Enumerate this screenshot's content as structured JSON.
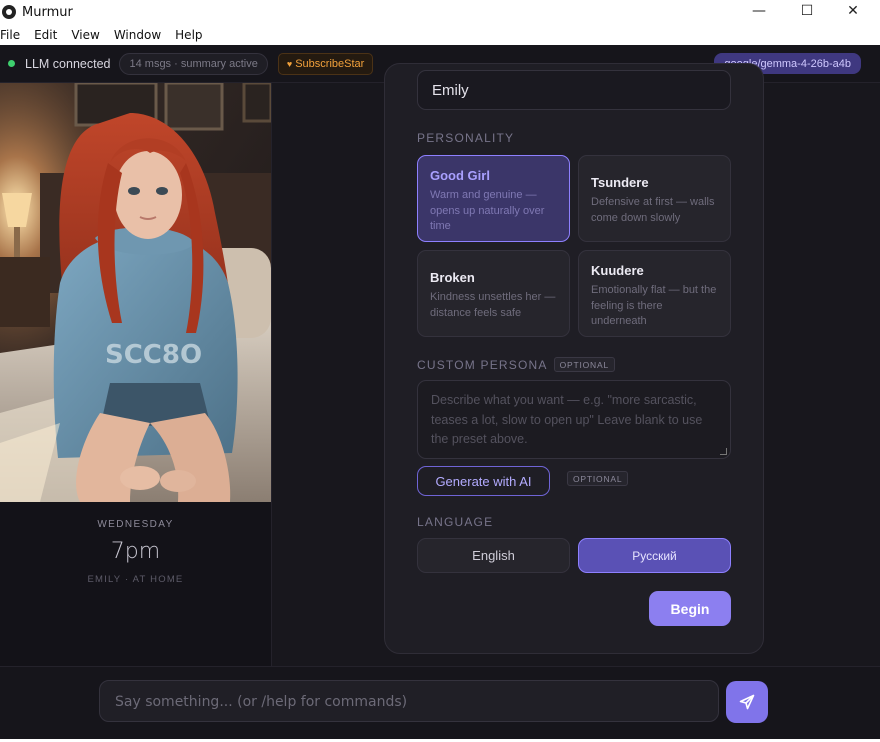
{
  "window": {
    "title": "Murmur",
    "minimize_glyph": "—",
    "maximize_glyph": "☐",
    "close_glyph": "✕"
  },
  "menu": [
    "File",
    "Edit",
    "View",
    "Window",
    "Help"
  ],
  "status": {
    "connection": "LLM connected",
    "summary": "14 msgs · summary active",
    "subscribe": "SubscribeStar",
    "model": "google/gemma-4-26b-a4b",
    "connected_color": "#3ecf6e"
  },
  "scene": {
    "day": "WEDNESDAY",
    "time": "7pm",
    "location": "EMILY · AT HOME"
  },
  "setup": {
    "name_value": "Emily",
    "personality_label": "PERSONALITY",
    "personalities": [
      {
        "name": "Good Girl",
        "desc": "Warm and genuine — opens up naturally over time",
        "selected": true
      },
      {
        "name": "Tsundere",
        "desc": "Defensive at first — walls come down slowly",
        "selected": false
      },
      {
        "name": "Broken",
        "desc": "Kindness unsettles her — distance feels safe",
        "selected": false
      },
      {
        "name": "Kuudere",
        "desc": "Emotionally flat — but the feeling is there underneath",
        "selected": false
      }
    ],
    "custom_label": "CUSTOM PERSONA",
    "optional_badge": "OPTIONAL",
    "custom_placeholder": "Describe what you want — e.g. \"more sarcastic, teases a lot, slow to open up\" Leave blank to use the preset above.",
    "generate_label": "Generate with AI",
    "generate_badge": "OPTIONAL",
    "language_label": "LANGUAGE",
    "languages": [
      {
        "label": "English",
        "selected": false
      },
      {
        "label": "Русский",
        "selected": true
      }
    ],
    "begin_label": "Begin"
  },
  "chat": {
    "placeholder": "Say something... (or /help for commands)"
  },
  "colors": {
    "accent": "#8c7ff0",
    "background": "#18171d",
    "card": "#1f1e25"
  },
  "icons": {
    "app": "app-logo-icon",
    "send": "send-icon",
    "heart": "heart-icon"
  }
}
